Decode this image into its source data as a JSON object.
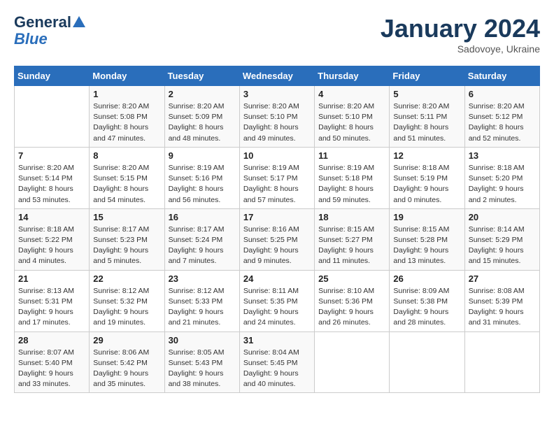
{
  "header": {
    "logo_line1": "General",
    "logo_line2": "Blue",
    "month": "January 2024",
    "location": "Sadovoye, Ukraine"
  },
  "weekdays": [
    "Sunday",
    "Monday",
    "Tuesday",
    "Wednesday",
    "Thursday",
    "Friday",
    "Saturday"
  ],
  "weeks": [
    [
      {
        "day": "",
        "info": ""
      },
      {
        "day": "1",
        "info": "Sunrise: 8:20 AM\nSunset: 5:08 PM\nDaylight: 8 hours\nand 47 minutes."
      },
      {
        "day": "2",
        "info": "Sunrise: 8:20 AM\nSunset: 5:09 PM\nDaylight: 8 hours\nand 48 minutes."
      },
      {
        "day": "3",
        "info": "Sunrise: 8:20 AM\nSunset: 5:10 PM\nDaylight: 8 hours\nand 49 minutes."
      },
      {
        "day": "4",
        "info": "Sunrise: 8:20 AM\nSunset: 5:10 PM\nDaylight: 8 hours\nand 50 minutes."
      },
      {
        "day": "5",
        "info": "Sunrise: 8:20 AM\nSunset: 5:11 PM\nDaylight: 8 hours\nand 51 minutes."
      },
      {
        "day": "6",
        "info": "Sunrise: 8:20 AM\nSunset: 5:12 PM\nDaylight: 8 hours\nand 52 minutes."
      }
    ],
    [
      {
        "day": "7",
        "info": "Sunrise: 8:20 AM\nSunset: 5:14 PM\nDaylight: 8 hours\nand 53 minutes."
      },
      {
        "day": "8",
        "info": "Sunrise: 8:20 AM\nSunset: 5:15 PM\nDaylight: 8 hours\nand 54 minutes."
      },
      {
        "day": "9",
        "info": "Sunrise: 8:19 AM\nSunset: 5:16 PM\nDaylight: 8 hours\nand 56 minutes."
      },
      {
        "day": "10",
        "info": "Sunrise: 8:19 AM\nSunset: 5:17 PM\nDaylight: 8 hours\nand 57 minutes."
      },
      {
        "day": "11",
        "info": "Sunrise: 8:19 AM\nSunset: 5:18 PM\nDaylight: 8 hours\nand 59 minutes."
      },
      {
        "day": "12",
        "info": "Sunrise: 8:18 AM\nSunset: 5:19 PM\nDaylight: 9 hours\nand 0 minutes."
      },
      {
        "day": "13",
        "info": "Sunrise: 8:18 AM\nSunset: 5:20 PM\nDaylight: 9 hours\nand 2 minutes."
      }
    ],
    [
      {
        "day": "14",
        "info": "Sunrise: 8:18 AM\nSunset: 5:22 PM\nDaylight: 9 hours\nand 4 minutes."
      },
      {
        "day": "15",
        "info": "Sunrise: 8:17 AM\nSunset: 5:23 PM\nDaylight: 9 hours\nand 5 minutes."
      },
      {
        "day": "16",
        "info": "Sunrise: 8:17 AM\nSunset: 5:24 PM\nDaylight: 9 hours\nand 7 minutes."
      },
      {
        "day": "17",
        "info": "Sunrise: 8:16 AM\nSunset: 5:25 PM\nDaylight: 9 hours\nand 9 minutes."
      },
      {
        "day": "18",
        "info": "Sunrise: 8:15 AM\nSunset: 5:27 PM\nDaylight: 9 hours\nand 11 minutes."
      },
      {
        "day": "19",
        "info": "Sunrise: 8:15 AM\nSunset: 5:28 PM\nDaylight: 9 hours\nand 13 minutes."
      },
      {
        "day": "20",
        "info": "Sunrise: 8:14 AM\nSunset: 5:29 PM\nDaylight: 9 hours\nand 15 minutes."
      }
    ],
    [
      {
        "day": "21",
        "info": "Sunrise: 8:13 AM\nSunset: 5:31 PM\nDaylight: 9 hours\nand 17 minutes."
      },
      {
        "day": "22",
        "info": "Sunrise: 8:12 AM\nSunset: 5:32 PM\nDaylight: 9 hours\nand 19 minutes."
      },
      {
        "day": "23",
        "info": "Sunrise: 8:12 AM\nSunset: 5:33 PM\nDaylight: 9 hours\nand 21 minutes."
      },
      {
        "day": "24",
        "info": "Sunrise: 8:11 AM\nSunset: 5:35 PM\nDaylight: 9 hours\nand 24 minutes."
      },
      {
        "day": "25",
        "info": "Sunrise: 8:10 AM\nSunset: 5:36 PM\nDaylight: 9 hours\nand 26 minutes."
      },
      {
        "day": "26",
        "info": "Sunrise: 8:09 AM\nSunset: 5:38 PM\nDaylight: 9 hours\nand 28 minutes."
      },
      {
        "day": "27",
        "info": "Sunrise: 8:08 AM\nSunset: 5:39 PM\nDaylight: 9 hours\nand 31 minutes."
      }
    ],
    [
      {
        "day": "28",
        "info": "Sunrise: 8:07 AM\nSunset: 5:40 PM\nDaylight: 9 hours\nand 33 minutes."
      },
      {
        "day": "29",
        "info": "Sunrise: 8:06 AM\nSunset: 5:42 PM\nDaylight: 9 hours\nand 35 minutes."
      },
      {
        "day": "30",
        "info": "Sunrise: 8:05 AM\nSunset: 5:43 PM\nDaylight: 9 hours\nand 38 minutes."
      },
      {
        "day": "31",
        "info": "Sunrise: 8:04 AM\nSunset: 5:45 PM\nDaylight: 9 hours\nand 40 minutes."
      },
      {
        "day": "",
        "info": ""
      },
      {
        "day": "",
        "info": ""
      },
      {
        "day": "",
        "info": ""
      }
    ]
  ]
}
